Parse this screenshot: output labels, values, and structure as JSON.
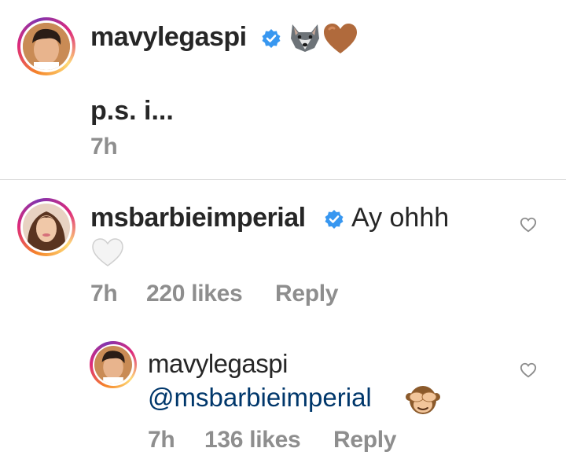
{
  "caption": {
    "username": "mavylegaspi",
    "emojis": [
      "wolf-emoji",
      "brown-heart-emoji"
    ],
    "text": "p.s. i...",
    "time": "7h"
  },
  "comment": {
    "username": "msbarbieimperial",
    "text": "Ay ohhh",
    "emoji": "white-heart-emoji",
    "time": "7h",
    "likes": "220 likes",
    "reply_label": "Reply"
  },
  "reply": {
    "username": "mavylegaspi",
    "mention": "@msbarbieimperial",
    "emoji": "see-no-evil-monkey-emoji",
    "time": "7h",
    "likes": "136 likes",
    "reply_label": "Reply"
  },
  "colors": {
    "verified": "#3897f0",
    "meta_gray": "#8e8e8e",
    "mention": "#00376b",
    "divider": "#dbdbdb"
  }
}
